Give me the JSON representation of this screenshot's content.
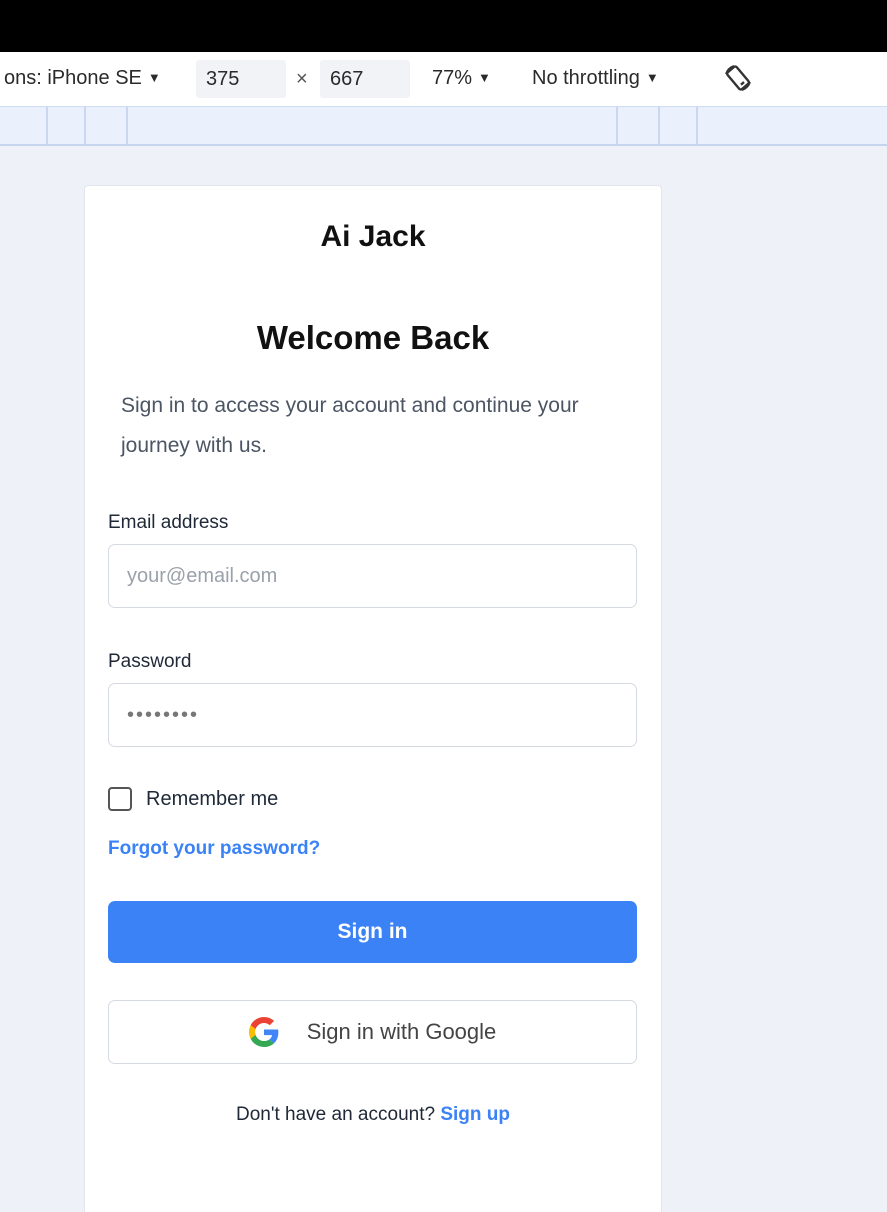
{
  "devtools": {
    "device_label": "ons: iPhone SE",
    "dropdown_glyph": "▼",
    "width": "375",
    "times": "×",
    "height": "667",
    "zoom": "77%",
    "throttling": "No throttling",
    "rotate_icon": "rotate-icon"
  },
  "login": {
    "brand": "Ai Jack",
    "heading": "Welcome Back",
    "subtitle": "Sign in to access your account and continue your journey with us.",
    "email_label": "Email address",
    "email_placeholder": "your@email.com",
    "password_label": "Password",
    "password_placeholder": "••••••••",
    "remember_label": "Remember me",
    "forgot_link": "Forgot your password?",
    "sign_in_button": "Sign in",
    "google_button": "Sign in with Google",
    "footer_text": "Don't have an account?",
    "signup_link": "Sign up"
  },
  "colors": {
    "accent": "#3b82f6",
    "background": "#eef2f8"
  }
}
